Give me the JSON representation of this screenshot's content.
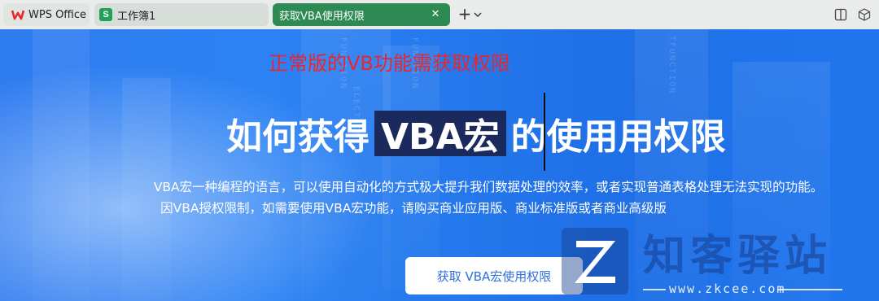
{
  "tabs": [
    {
      "label": "WPS Office"
    },
    {
      "label": "工作簿1",
      "icon_letter": "S"
    },
    {
      "label": "获取VBA使用权限"
    }
  ],
  "close_glyph": "✕",
  "new_tab_glyph": "+",
  "banner": {
    "red_caption": "正常版的VB功能需获取权限",
    "headline_prefix": "如何获得",
    "headline_highlight": "VBA宏",
    "headline_suffix": "的使用用权限",
    "description_line1": "VBA宏一种编程的语言，可以使用自动化的方式极大提升我们数据处理的效率，或者实现普通表格处理无法实现的功能。",
    "description_line2": "因VBA授权限制，如需要使用VBA宏功能，请购买商业应用版、商业标准版或者商业高级版",
    "cta_label": "获取 VBA宏使用权限",
    "bg_words": [
      "FUNCTION",
      "ELECTRON",
      "FUNCTION",
      "TFUNCTION"
    ]
  },
  "watermark": {
    "letter": "Z",
    "text": "知客驿站",
    "url": "www.zkcee.com"
  },
  "colors": {
    "active_tab": "#2d8a52",
    "banner_blue": "#2c82f4",
    "red_caption": "#e8262c",
    "highlight_bg": "#1b2a5c",
    "cta_text": "#2c6fe0"
  }
}
